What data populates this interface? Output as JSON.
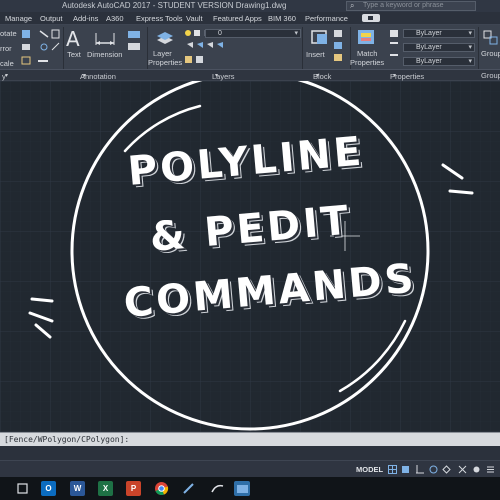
{
  "window": {
    "title": "Autodesk AutoCAD 2017 - STUDENT VERSION    Drawing1.dwg",
    "search_placeholder": "Type a keyword or phrase"
  },
  "ribbon_tabs": [
    "Manage",
    "Output",
    "Add-ins",
    "A360",
    "Express Tools",
    "Vault",
    "Featured Apps",
    "BIM 360",
    "Performance"
  ],
  "ribbon": {
    "left_partial": [
      "otate",
      "rror",
      "cale"
    ],
    "text_label": "Text",
    "dimension_label": "Dimension",
    "layer_properties_label_1": "Layer",
    "layer_properties_label_2": "Properties",
    "layer_dropdown_value": "0",
    "insert_label": "Insert",
    "match_properties_label_1": "Match",
    "match_properties_label_2": "Properties",
    "bylayer_1": "ByLayer",
    "bylayer_2": "ByLayer",
    "bylayer_3": "ByLayer",
    "groups_partial_1": "Group",
    "groups_partial_2": "Groups",
    "panel_labels": {
      "modify_partial": "y",
      "annotation": "Annotation",
      "layers": "Layers",
      "block": "Block",
      "properties": "Properties"
    }
  },
  "overlay": {
    "line1": "POLYLINE",
    "line2": "& PEDIT",
    "line3": "COMMANDS"
  },
  "command_line": "[Fence/WPolygon/CPolygon]:",
  "status": {
    "model_label": "MODEL"
  },
  "taskbar_apps": [
    "start-icon",
    "outlook-icon",
    "word-icon",
    "excel-icon",
    "powerpoint-icon",
    "chrome-icon",
    "pen-icon",
    "ink-icon",
    "photos-icon",
    "autocad-icon"
  ],
  "colors": {
    "canvas_bg": "#212830",
    "ribbon_bg": "#3b424e",
    "overlay_text": "#ffffff"
  }
}
